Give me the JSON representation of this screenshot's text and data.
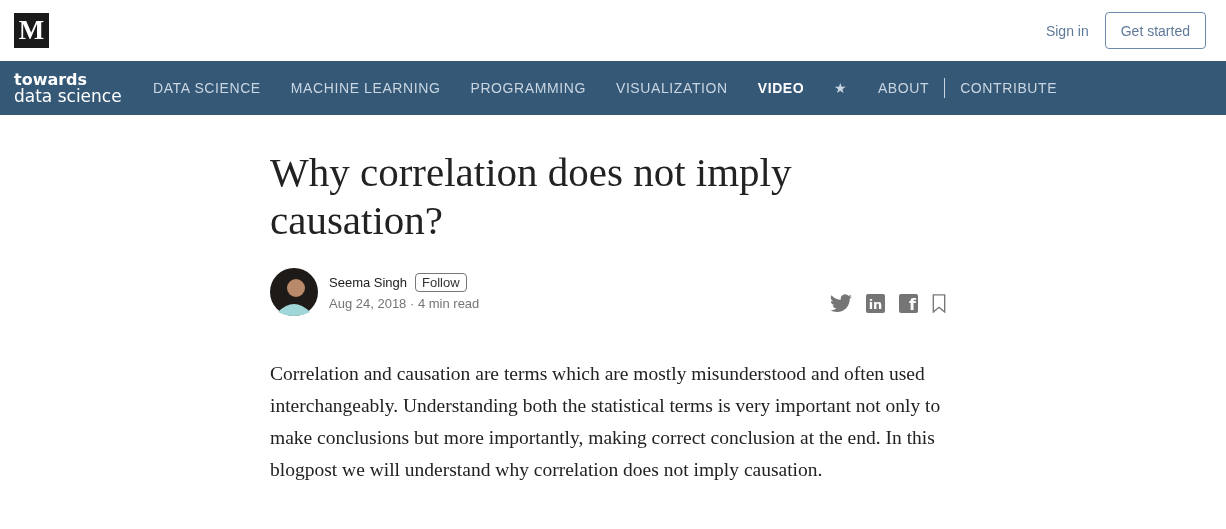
{
  "header": {
    "logo": "M",
    "sign_in": "Sign in",
    "get_started": "Get started"
  },
  "publication": {
    "logo_top": "towards",
    "logo_bottom": "data science",
    "nav": [
      {
        "label": "DATA SCIENCE",
        "selected": false
      },
      {
        "label": "MACHINE LEARNING",
        "selected": false
      },
      {
        "label": "PROGRAMMING",
        "selected": false
      },
      {
        "label": "VISUALIZATION",
        "selected": false
      },
      {
        "label": "VIDEO",
        "selected": true
      },
      {
        "label": "★",
        "selected": false
      },
      {
        "label": "ABOUT",
        "selected": false
      },
      {
        "label": "CONTRIBUTE",
        "selected": false
      }
    ]
  },
  "article": {
    "title": "Why correlation does not imply causation?",
    "author": {
      "name": "Seema Singh",
      "follow": "Follow",
      "meta": "Aug 24, 2018 · 4 min read"
    },
    "share": {
      "linkedin": "in",
      "facebook": "f"
    },
    "paragraphs": [
      "Correlation and causation are terms which are mostly misunderstood and often used interchangeably. Understanding both the statistical terms is very important not only to make conclusions but more importantly, making correct conclusion at the end. In this blogpost we will understand why correlation does not imply causation."
    ]
  }
}
